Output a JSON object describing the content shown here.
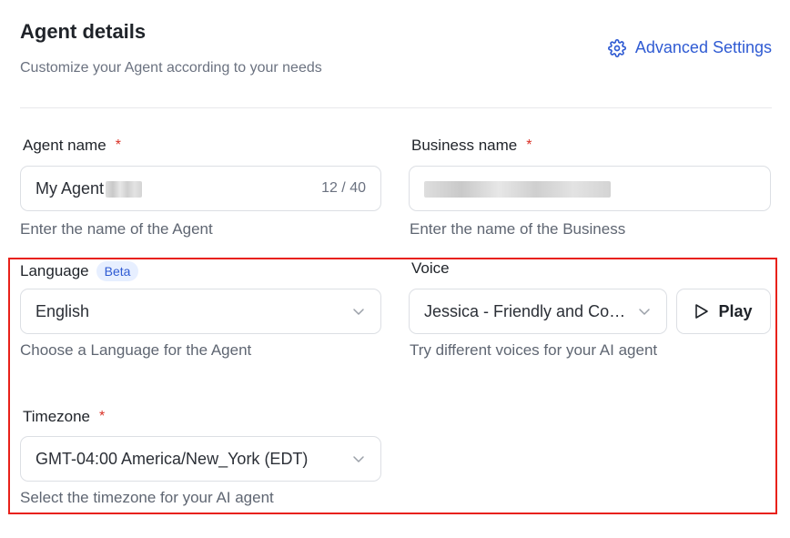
{
  "header": {
    "title": "Agent details",
    "subtitle": "Customize your Agent according to your needs",
    "advanced_settings_label": "Advanced Settings",
    "advanced_icon": "gear-icon"
  },
  "agent_name": {
    "label": "Agent name",
    "required_mark": "*",
    "value": "My Agent",
    "counter": "12 / 40",
    "help": "Enter the name of the Agent"
  },
  "business_name": {
    "label": "Business name",
    "required_mark": "*",
    "value": "",
    "help": "Enter the name of the Business"
  },
  "language": {
    "label": "Language",
    "badge": "Beta",
    "value": "English",
    "help": "Choose a Language for the Agent"
  },
  "voice": {
    "label": "Voice",
    "value": "Jessica - Friendly and Con...",
    "play_label": "Play",
    "help": "Try different voices for your AI agent"
  },
  "timezone": {
    "label": "Timezone",
    "required_mark": "*",
    "value": "GMT-04:00 America/New_York (EDT)",
    "help": "Select the timezone for your AI agent"
  },
  "colors": {
    "accent": "#2f5bd3",
    "required": "#d93025",
    "highlight": "#e8211a",
    "border": "#dcdfe4"
  }
}
